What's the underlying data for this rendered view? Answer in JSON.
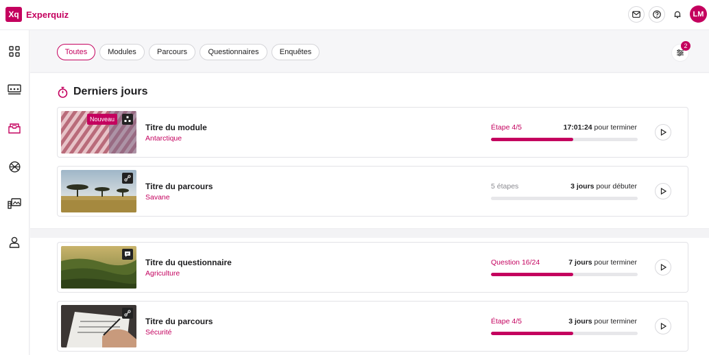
{
  "app": {
    "logo_text": "Xq",
    "title": "Experquiz",
    "brand_color": "#c4005e"
  },
  "header": {
    "icons": [
      "mail-icon",
      "help-icon",
      "bell-icon"
    ],
    "avatar_initials": "LM"
  },
  "sidebar": {
    "items": [
      {
        "name": "dashboard",
        "icon": "grid-icon"
      },
      {
        "name": "classroom",
        "icon": "classroom-icon"
      },
      {
        "name": "inbox",
        "icon": "inbox-icon",
        "active": true
      },
      {
        "name": "explore",
        "icon": "globe-icon"
      },
      {
        "name": "media",
        "icon": "media-icon"
      },
      {
        "name": "profile",
        "icon": "user-icon"
      }
    ]
  },
  "filters": {
    "chips": [
      {
        "label": "Toutes",
        "active": true
      },
      {
        "label": "Modules",
        "active": false
      },
      {
        "label": "Parcours",
        "active": false
      },
      {
        "label": "Questionnaires",
        "active": false
      },
      {
        "label": "Enquêtes",
        "active": false
      }
    ],
    "badge_count": "2"
  },
  "section": {
    "title": "Derniers jours"
  },
  "cards": [
    {
      "title": "Titre du module",
      "subtitle": "Antarctique",
      "step": "Étape 4/5",
      "time_bold": "17:01:24",
      "time_rest": " pour terminer",
      "progress": 0.56,
      "badge": "Nouveau",
      "type_icon": "module-icon",
      "muted": false
    },
    {
      "title": "Titre du parcours",
      "subtitle": "Savane",
      "step": "5 étapes",
      "time_bold": "3 jours",
      "time_rest": " pour débuter",
      "progress": 0,
      "type_icon": "path-icon",
      "muted": true
    },
    {
      "title": "Titre du questionnaire",
      "subtitle": "Agriculture",
      "step": "Question 16/24",
      "time_bold": "7 jours",
      "time_rest": " pour terminer",
      "progress": 0.56,
      "type_icon": "questionnaire-icon",
      "muted": false
    },
    {
      "title": "Titre du parcours",
      "subtitle": "Sécurité",
      "step": "Étape 4/5",
      "time_bold": "3 jours",
      "time_rest": " pour terminer",
      "progress": 0.56,
      "type_icon": "path-icon",
      "muted": false
    }
  ]
}
